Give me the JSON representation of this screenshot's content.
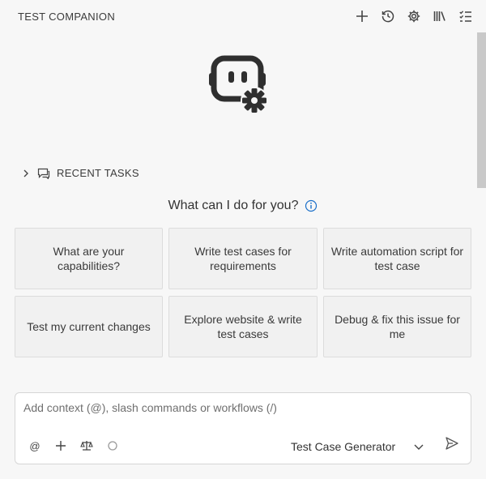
{
  "header": {
    "title": "TEST COMPANION",
    "actions": [
      "plus-icon",
      "history-icon",
      "gear-icon",
      "library-icon",
      "checklist-icon"
    ]
  },
  "logo": "robot-gear-icon",
  "recent_tasks": {
    "label": "RECENT TASKS"
  },
  "prompt": {
    "heading": "What can I do for you?"
  },
  "suggestions": [
    "What are your capabilities?",
    "Write test cases for requirements",
    "Write automation script for test case",
    "Test my current changes",
    "Explore website & write test cases",
    "Debug & fix this issue for me"
  ],
  "composer": {
    "placeholder": "Add context (@), slash commands or workflows (/)",
    "mention_label": "@",
    "mode": "Test Case Generator"
  },
  "colors": {
    "info": "#1a6fc9",
    "icon": "#444444",
    "background": "#f7f7f7"
  }
}
